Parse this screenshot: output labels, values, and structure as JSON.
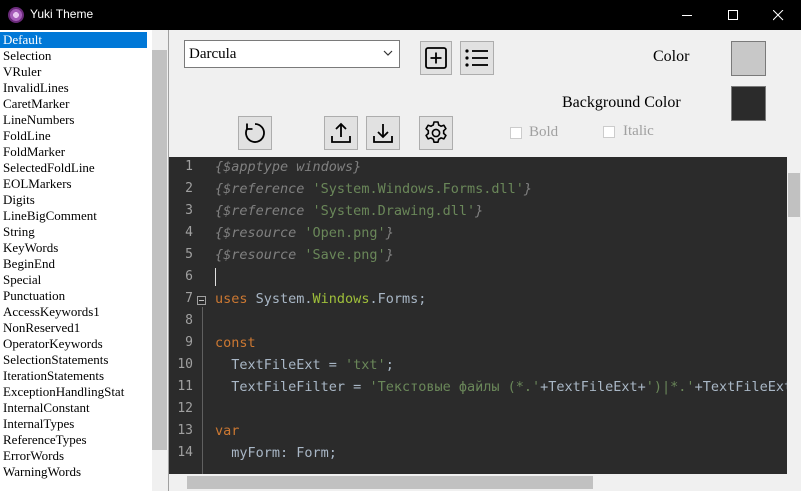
{
  "window": {
    "title": "Yuki Theme"
  },
  "list": {
    "selected_index": 0,
    "items": [
      "Default",
      "Selection",
      "VRuler",
      "InvalidLines",
      "CaretMarker",
      "LineNumbers",
      "FoldLine",
      "FoldMarker",
      "SelectedFoldLine",
      "EOLMarkers",
      "Digits",
      "LineBigComment",
      "String",
      "KeyWords",
      "BeginEnd",
      "Special",
      "Punctuation",
      "AccessKeywords1",
      "NonReserved1",
      "OperatorKeywords",
      "SelectionStatements",
      "IterationStatements",
      "ExceptionHandlingStat",
      "InternalConstant",
      "InternalTypes",
      "ReferenceTypes",
      "ErrorWords",
      "WarningWords"
    ]
  },
  "theme_select": {
    "value": "Darcula"
  },
  "toolbar": {
    "add_icon": "plus-square-icon",
    "list_icon": "list-icon",
    "reset_icon": "refresh-icon",
    "export_icon": "upload-icon",
    "import_icon": "download-icon",
    "settings_icon": "gear-icon"
  },
  "color": {
    "label": "Color",
    "value": "#c8c8c8"
  },
  "background_color": {
    "label": "Background Color",
    "value": "#2b2b2b"
  },
  "bold": {
    "label": "Bold",
    "checked": false,
    "enabled": false
  },
  "italic": {
    "label": "Italic",
    "checked": false,
    "enabled": false
  },
  "editor": {
    "background": "#2b2b2b",
    "line_numbers": [
      "1",
      "2",
      "3",
      "4",
      "5",
      "6",
      "7",
      "8",
      "9",
      "10",
      "11",
      "12",
      "13",
      "14"
    ],
    "lines": [
      [
        {
          "t": "{$apptype windows}",
          "c": "c-cmt"
        }
      ],
      [
        {
          "t": "{$reference ",
          "c": "c-cmt"
        },
        {
          "t": "'System.Windows.Forms.dll'",
          "c": "c-str"
        },
        {
          "t": "}",
          "c": "c-cmt"
        }
      ],
      [
        {
          "t": "{$reference ",
          "c": "c-cmt"
        },
        {
          "t": "'System.Drawing.dll'",
          "c": "c-str"
        },
        {
          "t": "}",
          "c": "c-cmt"
        }
      ],
      [
        {
          "t": "{$resource ",
          "c": "c-cmt"
        },
        {
          "t": "'Open.png'",
          "c": "c-str"
        },
        {
          "t": "}",
          "c": "c-cmt"
        }
      ],
      [
        {
          "t": "{$resource ",
          "c": "c-cmt"
        },
        {
          "t": "'Save.png'",
          "c": "c-str"
        },
        {
          "t": "}",
          "c": "c-cmt"
        }
      ],
      [],
      [
        {
          "t": "uses ",
          "c": "c-kw"
        },
        {
          "t": "System.",
          "c": "c-id"
        },
        {
          "t": "Windows",
          "c": "c-ns"
        },
        {
          "t": ".Forms;",
          "c": "c-id"
        }
      ],
      [],
      [
        {
          "t": "const",
          "c": "c-kw"
        }
      ],
      [
        {
          "t": "  TextFileExt = ",
          "c": "c-id"
        },
        {
          "t": "'txt'",
          "c": "c-str"
        },
        {
          "t": ";",
          "c": "c-id"
        }
      ],
      [
        {
          "t": "  TextFileFilter = ",
          "c": "c-id"
        },
        {
          "t": "'Текстовые файлы (*.'",
          "c": "c-str"
        },
        {
          "t": "+TextFileExt+",
          "c": "c-id"
        },
        {
          "t": "')|*.'",
          "c": "c-str"
        },
        {
          "t": "+TextFileExt",
          "c": "c-id"
        }
      ],
      [],
      [
        {
          "t": "var",
          "c": "c-kw"
        }
      ],
      [
        {
          "t": "  myForm: Form;",
          "c": "c-id"
        }
      ]
    ]
  }
}
